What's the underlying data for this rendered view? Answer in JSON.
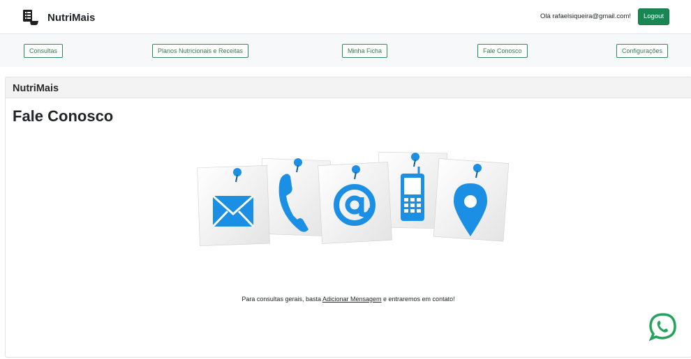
{
  "header": {
    "brand_name": "NutriMais",
    "greeting": "Olá rafaelsiqueira@gmail.com!",
    "logout_label": "Logout"
  },
  "nav": {
    "items": [
      {
        "label": "Consultas"
      },
      {
        "label": "Planos Nutricionais e Receitas"
      },
      {
        "label": "Minha Ficha"
      },
      {
        "label": "Fale Conosco"
      },
      {
        "label": "Configurações"
      }
    ]
  },
  "card": {
    "header": "NutriMais",
    "title": "Fale Conosco",
    "text_before": "Para consultas gerais, basta ",
    "link_label": "Adicionar Mensagem",
    "text_after": " e entraremos em contato!"
  },
  "icons": {
    "contact_cards": [
      "envelope-icon",
      "phone-icon",
      "at-sign-icon",
      "mobile-phone-icon",
      "location-pin-icon"
    ],
    "floating": "whatsapp-icon"
  },
  "colors": {
    "primary_green": "#198754",
    "icon_blue": "#1a8fe3",
    "whatsapp_green": "#25a35a"
  }
}
